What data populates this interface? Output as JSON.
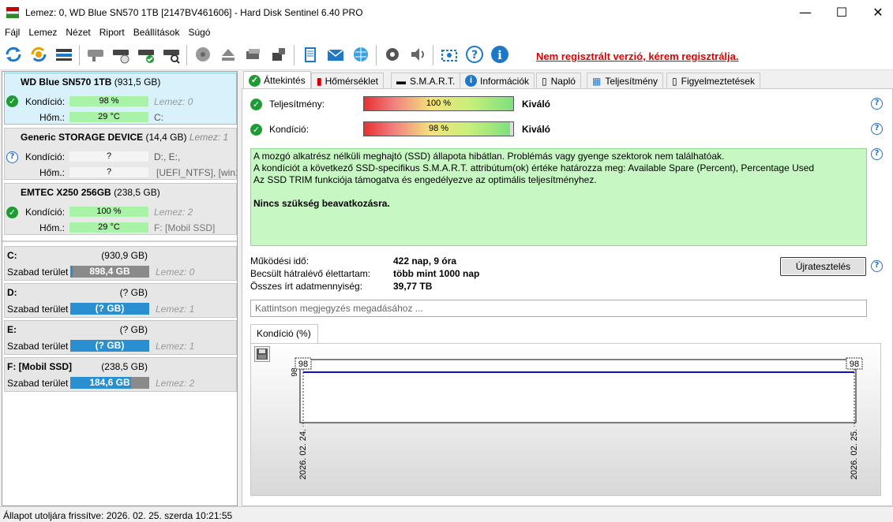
{
  "window": {
    "title": "Lemez: 0, WD Blue SN570 1TB [2147BV461606]  -  Hard Disk Sentinel 6.40 PRO",
    "minimize": "—",
    "maximize": "☐",
    "close": "✕"
  },
  "menu": [
    "Fájl",
    "Lemez",
    "Nézet",
    "Riport",
    "Beállítások",
    "Súgó"
  ],
  "toolbar": {
    "unregistered": "Nem regisztrált verzió, kérem regisztrálja."
  },
  "disks": [
    {
      "name": "WD Blue SN570 1TB",
      "size": "(931,5 GB)",
      "cond_label": "Kondíció:",
      "cond_value": "98 %",
      "cond_pct": 98,
      "disk_no": "Lemez: 0",
      "temp_label": "Hőm.:",
      "temp_value": "29 °C",
      "volumes": "C:",
      "status": "ok"
    },
    {
      "name": "Generic STORAGE DEVICE",
      "size": "(14,4 GB)",
      "disk_no": "Lemez: 1",
      "cond_label": "Kondíció:",
      "cond_value": "?",
      "temp_label": "Hőm.:",
      "temp_value": "?",
      "volumes": "D:, E:,",
      "volumes2": "[UEFI_NTFS],  [win10",
      "status": "unknown"
    },
    {
      "name": "EMTEC X250 256GB",
      "size": "(238,5 GB)",
      "cond_label": "Kondíció:",
      "cond_value": "100 %",
      "cond_pct": 100,
      "disk_no": "Lemez: 2",
      "temp_label": "Hőm.:",
      "temp_value": "29 °C",
      "volumes": "F: [Mobil SSD]",
      "status": "ok"
    }
  ],
  "volumes": [
    {
      "name": "C:",
      "size": "(930,9 GB)",
      "free_label": "Szabad terület",
      "free": "898,4 GB",
      "free_pct": 96,
      "disk": "Lemez: 0",
      "color": "#8a8a8a"
    },
    {
      "name": "D:",
      "size": "(? GB)",
      "free_label": "Szabad terület",
      "free": "(? GB)",
      "free_pct": 100,
      "disk": "Lemez: 1",
      "color": "#2a8fd0"
    },
    {
      "name": "E:",
      "size": "(? GB)",
      "free_label": "Szabad terület",
      "free": "(? GB)",
      "free_pct": 100,
      "disk": "Lemez: 1",
      "color": "#2a8fd0"
    },
    {
      "name": "F: [Mobil SSD]",
      "size": "(238,5 GB)",
      "free_label": "Szabad terület",
      "free": "184,6 GB",
      "free_pct": 77,
      "disk": "Lemez: 2",
      "color": "#2a8fd0"
    }
  ],
  "tabs": [
    "Áttekintés",
    "Hőmérséklet",
    "S.M.A.R.T.",
    "Információk",
    "Napló",
    "Teljesítmény",
    "Figyelmeztetések"
  ],
  "overview": {
    "performance_label": "Teljesítmény:",
    "performance_value": "100 %",
    "performance_pct": 100,
    "performance_rating": "Kiváló",
    "health_label": "Kondíció:",
    "health_value": "98 %",
    "health_pct": 98,
    "health_rating": "Kiváló",
    "status_line1": "A mozgó alkatrész nélküli meghajtó (SSD) állapota hibátlan. Problémás vagy gyenge szektorok nem találhatóak.",
    "status_line2": "A kondíciót a következő SSD-specifikus S.M.A.R.T. attribútum(ok) értéke határozza meg:  Available Spare (Percent), Percentage Used",
    "status_line3": "Az SSD TRIM funkciója támogatva és engedélyezve az optimális teljesítményhez.",
    "status_action": "Nincs szükség beavatkozásra.",
    "uptime_label": "Működési idő:",
    "uptime_value": "422 nap, 9 óra",
    "remaining_label": "Becsült hátralévő élettartam:",
    "remaining_value": "több mint 1000 nap",
    "written_label": "Összes írt adatmennyiség:",
    "written_value": "39,77 TB",
    "retest_button": "Újratesztelés",
    "note_placeholder": "Kattintson megjegyzés megadásához ...",
    "help": "?"
  },
  "chart_tab": "Kondíció  (%)",
  "chart_data": {
    "type": "line",
    "x": [
      "2026. 02. 24.",
      "2026. 02. 25."
    ],
    "series": [
      {
        "values": [
          98,
          98
        ]
      }
    ],
    "y_tick": "98",
    "color": "#1010c0"
  },
  "statusbar": "Állapot utoljára frissítve: 2026. 02. 25. szerda 10:21:55"
}
